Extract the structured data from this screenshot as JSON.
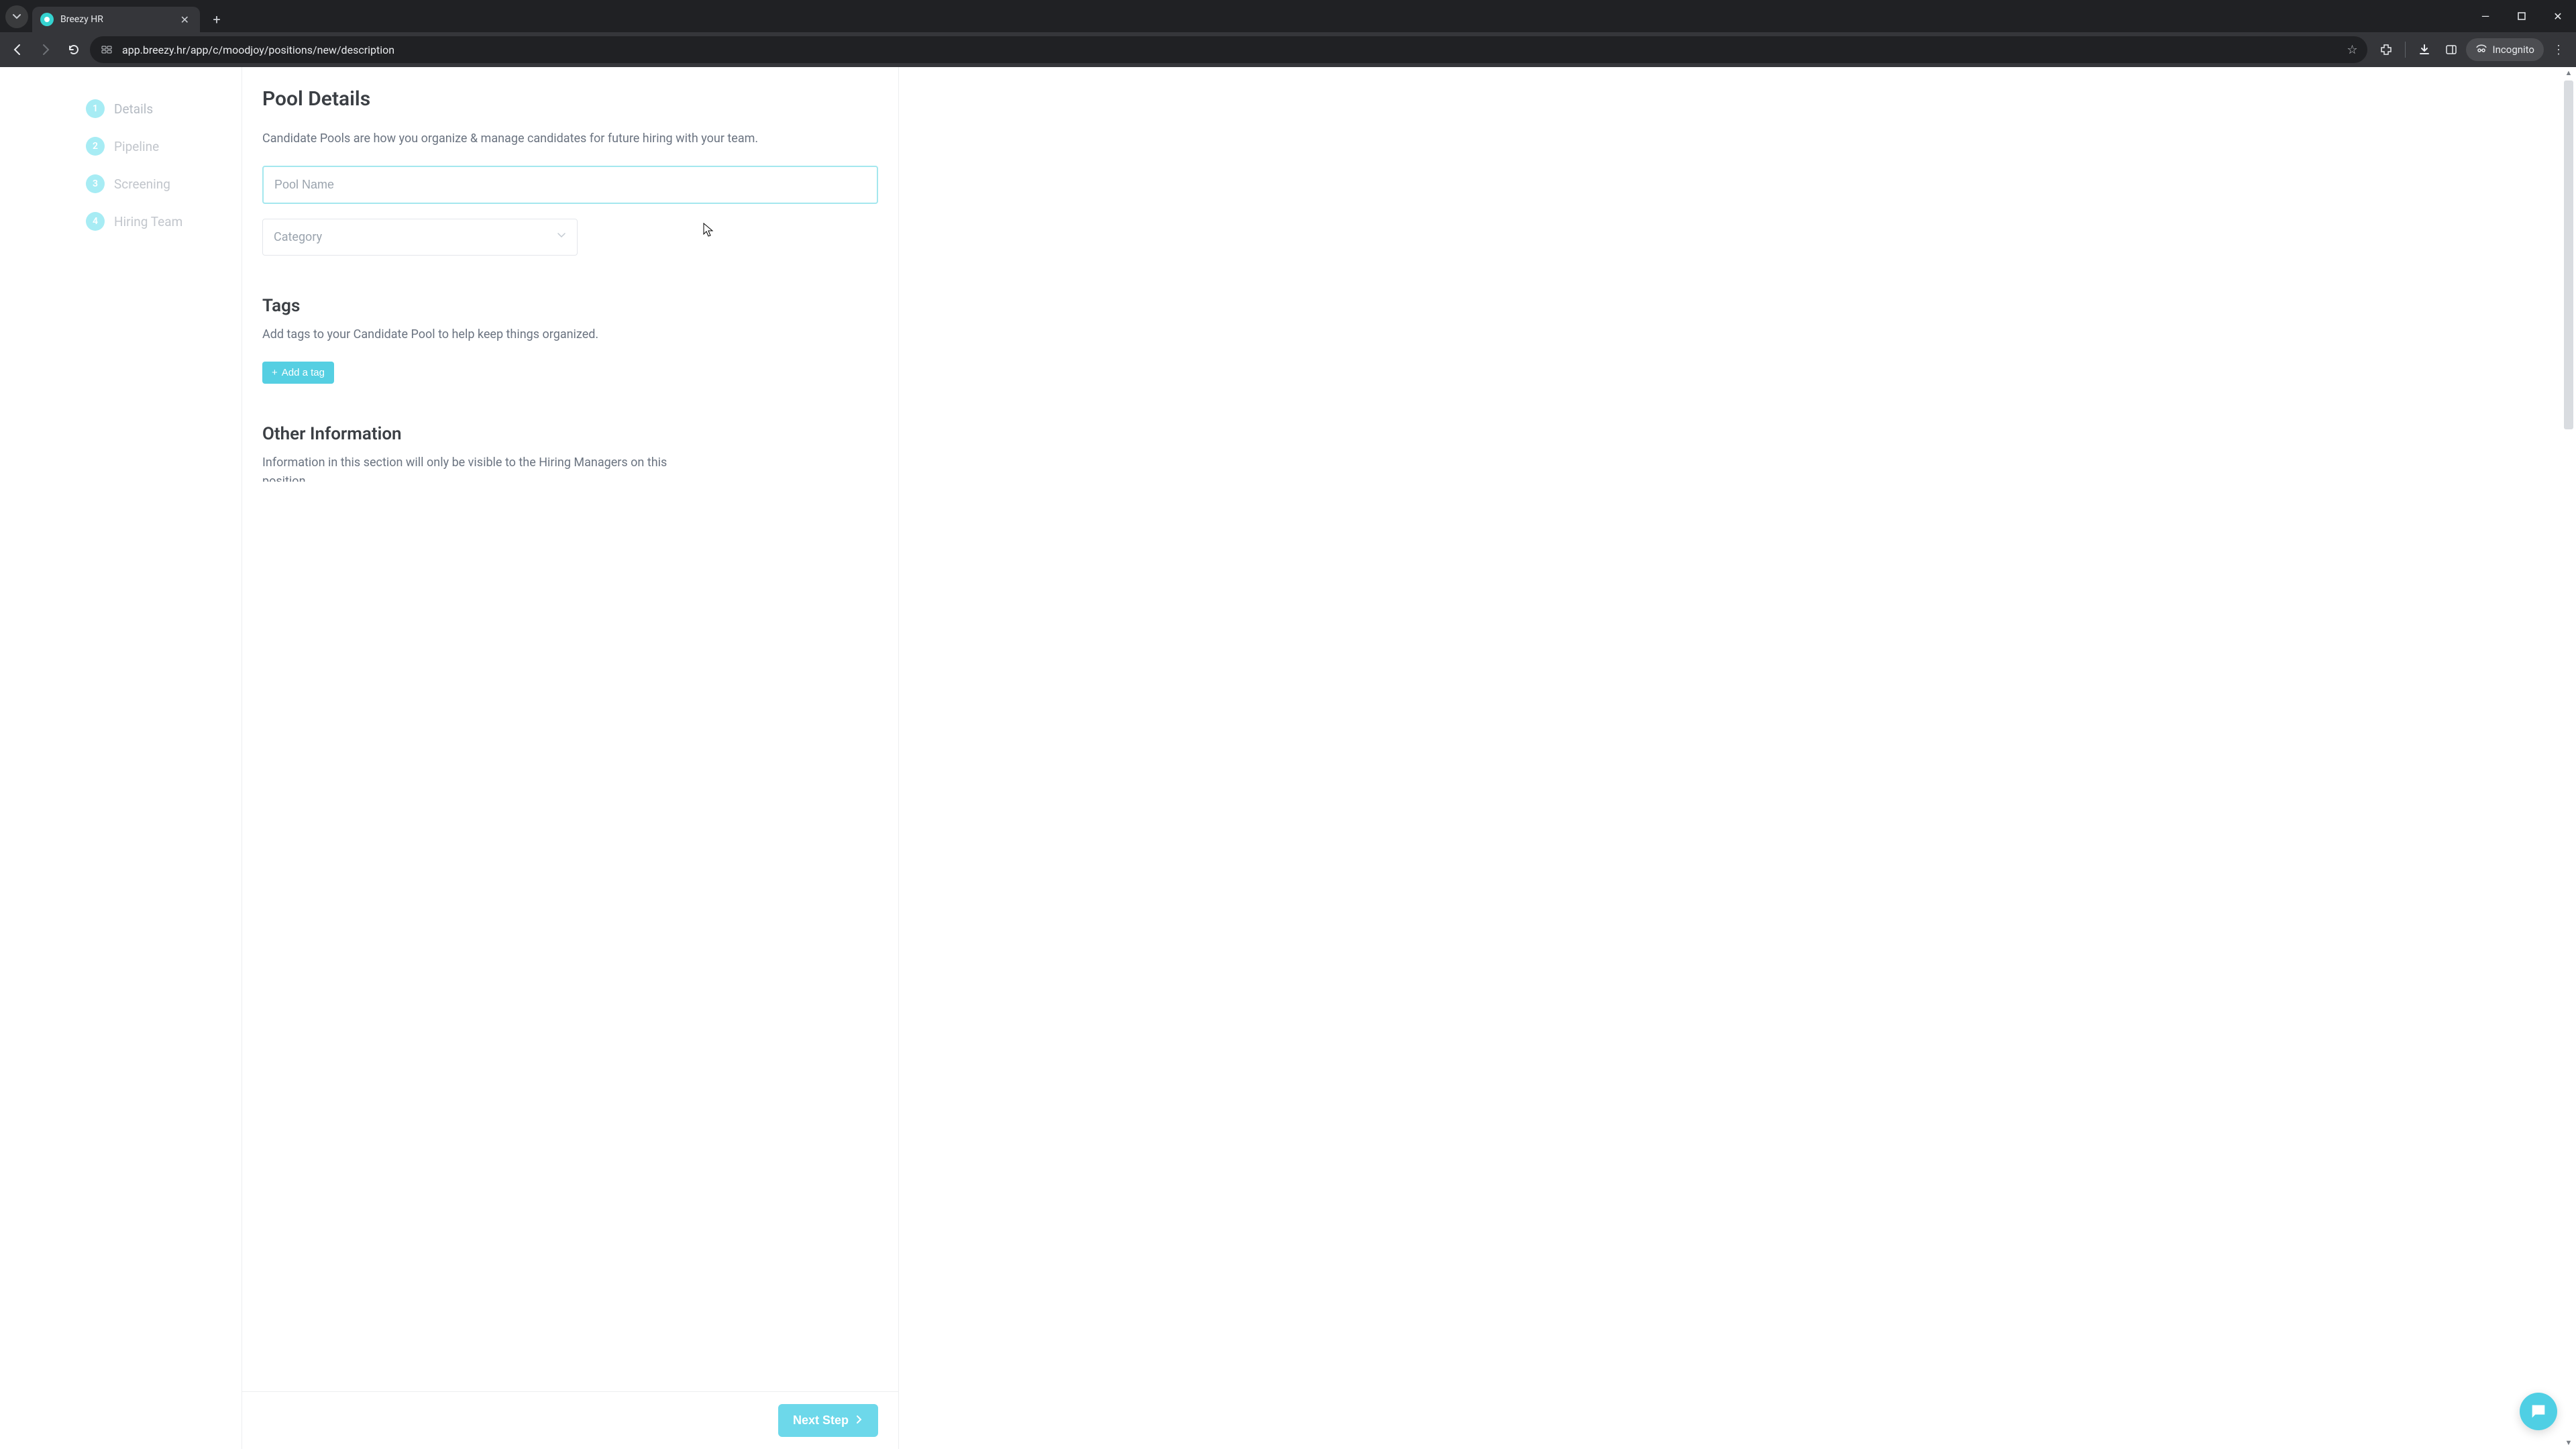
{
  "browser": {
    "tab_title": "Breezy HR",
    "url": "app.breezy.hr/app/c/moodjoy/positions/new/description",
    "incognito_label": "Incognito"
  },
  "sidebar": {
    "steps": [
      {
        "num": "1",
        "label": "Details"
      },
      {
        "num": "2",
        "label": "Pipeline"
      },
      {
        "num": "3",
        "label": "Screening"
      },
      {
        "num": "4",
        "label": "Hiring Team"
      }
    ]
  },
  "pool_details": {
    "title": "Pool Details",
    "desc": "Candidate Pools are how you organize & manage candidates for future hiring with your team.",
    "pool_name_placeholder": "Pool Name",
    "pool_name_value": "",
    "category_placeholder": "Category"
  },
  "tags": {
    "title": "Tags",
    "desc": "Add tags to your Candidate Pool to help keep things organized.",
    "add_button": "Add a tag"
  },
  "other_info": {
    "title": "Other Information",
    "desc_line1": "Information in this section will only be visible to the Hiring Managers on this",
    "desc_line2_clipped": "position"
  },
  "footer": {
    "next_label": "Next Step"
  }
}
